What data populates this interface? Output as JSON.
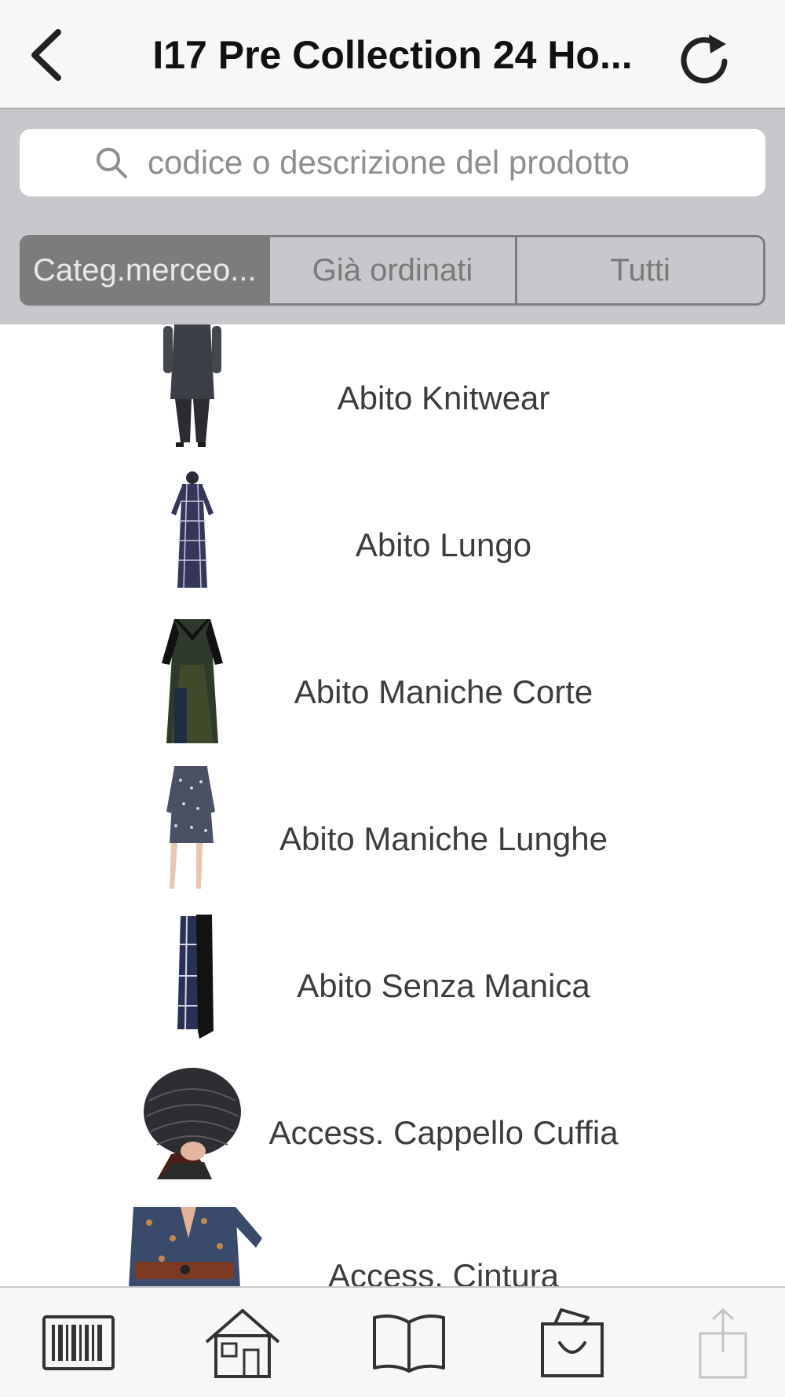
{
  "navbar": {
    "title": "I17 Pre Collection 24 Ho...",
    "back_icon": "chevron-left-icon",
    "refresh_icon": "refresh-icon"
  },
  "search": {
    "placeholder": "codice o descrizione del prodotto",
    "value": ""
  },
  "segments": [
    {
      "label": "Categ.merceo...",
      "selected": true
    },
    {
      "label": "Già ordinati",
      "selected": false
    },
    {
      "label": "Tutti",
      "selected": false
    }
  ],
  "categories": [
    {
      "label": "Abito Knitwear"
    },
    {
      "label": "Abito Lungo"
    },
    {
      "label": "Abito Maniche Corte"
    },
    {
      "label": "Abito Maniche Lunghe"
    },
    {
      "label": "Abito Senza Manica"
    },
    {
      "label": "Access. Cappello Cuffia"
    },
    {
      "label": "Access. Cintura"
    }
  ],
  "tabbar": [
    {
      "icon": "barcode-icon"
    },
    {
      "icon": "home-icon"
    },
    {
      "icon": "catalog-book-icon"
    },
    {
      "icon": "shopping-bag-icon"
    },
    {
      "icon": "share-icon",
      "enabled": false
    }
  ],
  "colors": {
    "nav_background": "#f7f7f7",
    "panel_background": "#c8c8cc",
    "segment_active": "#7c7c7c",
    "text_primary": "#111111",
    "text_secondary": "#3c3c3c"
  }
}
